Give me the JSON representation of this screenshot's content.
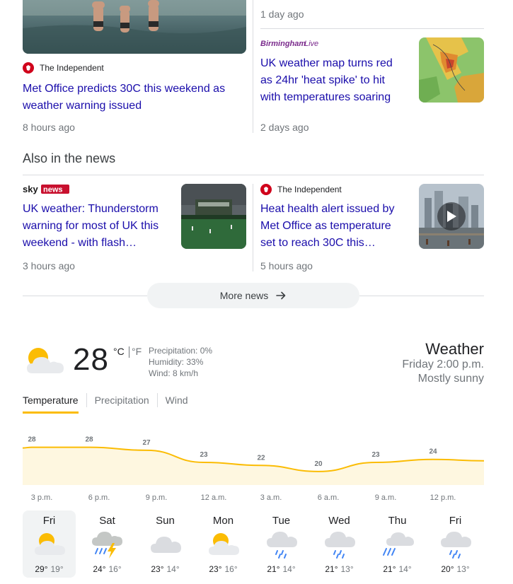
{
  "news_top": [
    {
      "source": "The Independent",
      "headline": "Met Office predicts 30C this weekend as weather warning issued",
      "age": "8 hours ago"
    },
    {
      "source": "Birmingham Live",
      "headline": "UK weather map turns red as 24hr 'heat spike' to hit with temperatures soaring",
      "age": "2 days ago",
      "age_above": "1 day ago"
    }
  ],
  "also_in_news": {
    "title": "Also in the news",
    "items": [
      {
        "source": "Sky News",
        "headline": "UK weather: Thunderstorm warning for most of UK this weekend - with flash…",
        "age": "3 hours ago"
      },
      {
        "source": "The Independent",
        "headline": "Heat health alert issued by Met Office as temperature set to reach 30C this…",
        "age": "5 hours ago"
      }
    ]
  },
  "more_news_label": "More news",
  "weather": {
    "title": "Weather",
    "datetime": "Friday 2:00 p.m.",
    "condition": "Mostly sunny",
    "current_temp": "28",
    "unit_c": "°C",
    "unit_f": "°F",
    "precipitation": "Precipitation: 0%",
    "humidity": "Humidity: 33%",
    "wind": "Wind: 8 km/h",
    "tabs": [
      "Temperature",
      "Precipitation",
      "Wind"
    ],
    "active_tab": "Temperature",
    "accent_color": "#fbbc04"
  },
  "chart_data": {
    "type": "area",
    "x": [
      "3 p.m.",
      "6 p.m.",
      "9 p.m.",
      "12 a.m.",
      "3 a.m.",
      "6 a.m.",
      "9 a.m.",
      "12 p.m."
    ],
    "values": [
      28,
      28,
      27,
      23,
      22,
      20,
      23,
      24
    ],
    "value_labels": [
      "28",
      "28",
      "27",
      "23",
      "22",
      "20",
      "23",
      "24"
    ],
    "fill_color": "#fef7e0",
    "line_color": "#fbbc04"
  },
  "forecast": [
    {
      "day": "Fri",
      "hi": "29°",
      "lo": "19°",
      "icon": "partly-cloudy-sun-icon"
    },
    {
      "day": "Sat",
      "hi": "24°",
      "lo": "16°",
      "icon": "thunderstorm-icon"
    },
    {
      "day": "Sun",
      "hi": "23°",
      "lo": "14°",
      "icon": "cloudy-icon"
    },
    {
      "day": "Mon",
      "hi": "23°",
      "lo": "16°",
      "icon": "partly-cloudy-sun-icon"
    },
    {
      "day": "Tue",
      "hi": "21°",
      "lo": "14°",
      "icon": "rain-icon"
    },
    {
      "day": "Wed",
      "hi": "21°",
      "lo": "13°",
      "icon": "rain-icon"
    },
    {
      "day": "Thu",
      "hi": "21°",
      "lo": "14°",
      "icon": "showers-icon"
    },
    {
      "day": "Fri",
      "hi": "20°",
      "lo": "13°",
      "icon": "rain-icon"
    }
  ]
}
